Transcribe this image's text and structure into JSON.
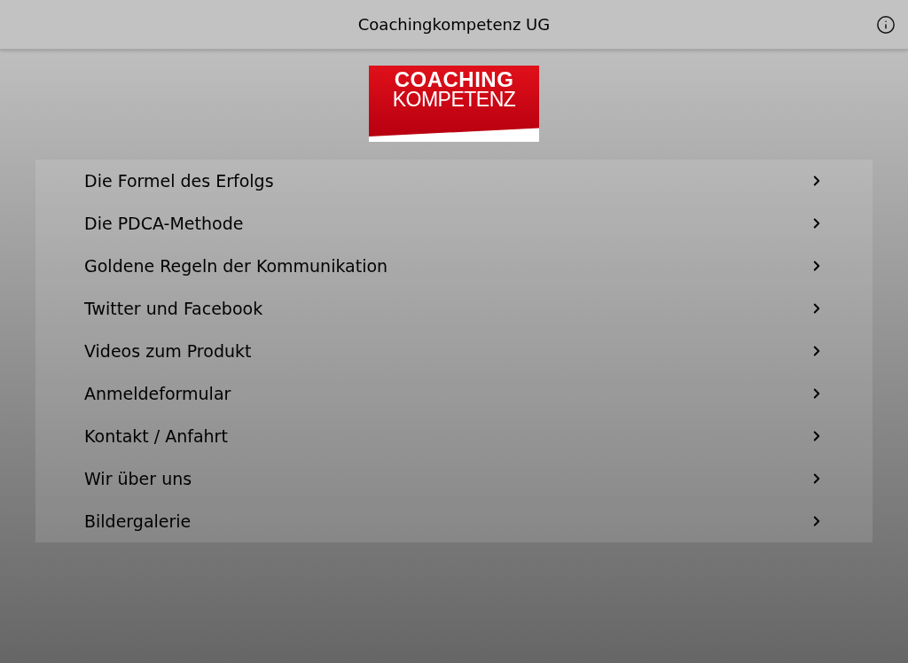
{
  "header": {
    "title": "Coachingkompetenz UG"
  },
  "logo": {
    "lines": [
      "COACHING",
      "KOMPETENZ"
    ]
  },
  "menu": {
    "items": [
      {
        "label": "Die Formel des Erfolgs"
      },
      {
        "label": "Die PDCA-Methode"
      },
      {
        "label": "Goldene Regeln der Kommunikation"
      },
      {
        "label": "Twitter und Facebook"
      },
      {
        "label": "Videos zum Produkt"
      },
      {
        "label": "Anmeldeformular"
      },
      {
        "label": "Kontakt / Anfahrt"
      },
      {
        "label": "Wir über uns"
      },
      {
        "label": "Bildergalerie"
      }
    ]
  }
}
